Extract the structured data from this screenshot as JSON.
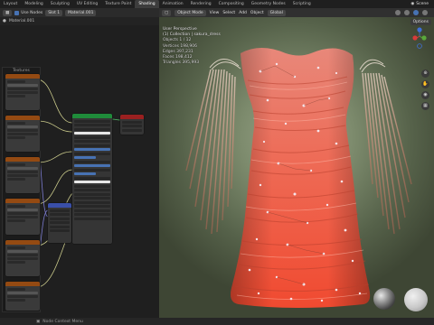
{
  "topbar": {
    "workspace_tabs": [
      "Layout",
      "Modeling",
      "Sculpting",
      "UV Editing",
      "Texture Paint",
      "Shading",
      "Animation",
      "Rendering",
      "Compositing",
      "Geometry Nodes",
      "Scripting"
    ],
    "active_tab": "Shading",
    "scene_label": "Scene"
  },
  "node_editor": {
    "use_nodes_label": "Use Nodes",
    "slot_label": "Slot 1",
    "material_name": "Material.001",
    "breadcrumb": "Material.001",
    "frame_label": "Textures"
  },
  "viewport": {
    "mode_label": "Object Mode",
    "menu": [
      "View",
      "Select",
      "Add",
      "Object"
    ],
    "orientation_label": "Global",
    "options_label": "Options",
    "overlay_title": "User Perspective",
    "overlay_subtitle": "(1) Collection | sakura_dress",
    "stats": [
      "Objects  1 / 12",
      "Vertices  198,906",
      "Edges  397,231",
      "Faces  198,412",
      "Triangles  395,993"
    ]
  },
  "statusbar": {
    "label": "Node Context Menu"
  },
  "colors": {
    "texture_node_header": "#944a12",
    "bsdf_header": "#1f8b3a",
    "output_header": "#9a2020",
    "vector_header": "#3a4fa8",
    "accent_blue": "#4772b3",
    "dress": "#ec5c44"
  }
}
